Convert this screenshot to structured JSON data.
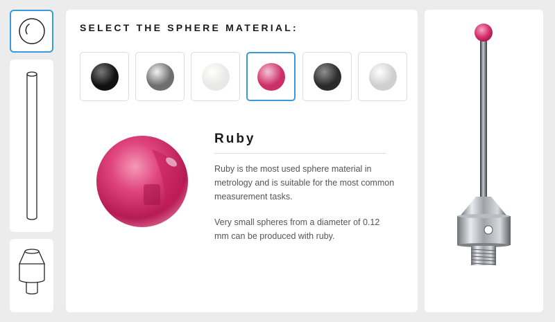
{
  "heading": "SELECT THE SPHERE MATERIAL:",
  "materials": [
    {
      "color": "#111111",
      "highlight": "#7a7a7a",
      "selected": false
    },
    {
      "color": "#6e6e6e",
      "highlight": "#f2f2f2",
      "selected": false
    },
    {
      "color": "#e8e8e6",
      "highlight": "#ffffff",
      "selected": false
    },
    {
      "color": "#cc2e66",
      "highlight": "#f5c4d6",
      "selected": true
    },
    {
      "color": "#2b2b2b",
      "highlight": "#8f8f8f",
      "selected": false
    },
    {
      "color": "#cfcfcf",
      "highlight": "#ffffff",
      "selected": false
    }
  ],
  "selected_material": {
    "name": "Ruby",
    "color": "#d0346f",
    "description_1": "Ruby is the most used sphere material in metrology and is suitable for the most common measurement tasks.",
    "description_2": "Very small spheres from a diameter of 0.12 mm can be produced with ruby."
  },
  "colors": {
    "accent": "#3a9ad9",
    "background": "#ececec",
    "panel": "#ffffff"
  },
  "icons": {
    "sphere_tab": "sphere-outline-icon",
    "stem_tab": "stem-outline-icon",
    "base_tab": "base-outline-icon"
  }
}
